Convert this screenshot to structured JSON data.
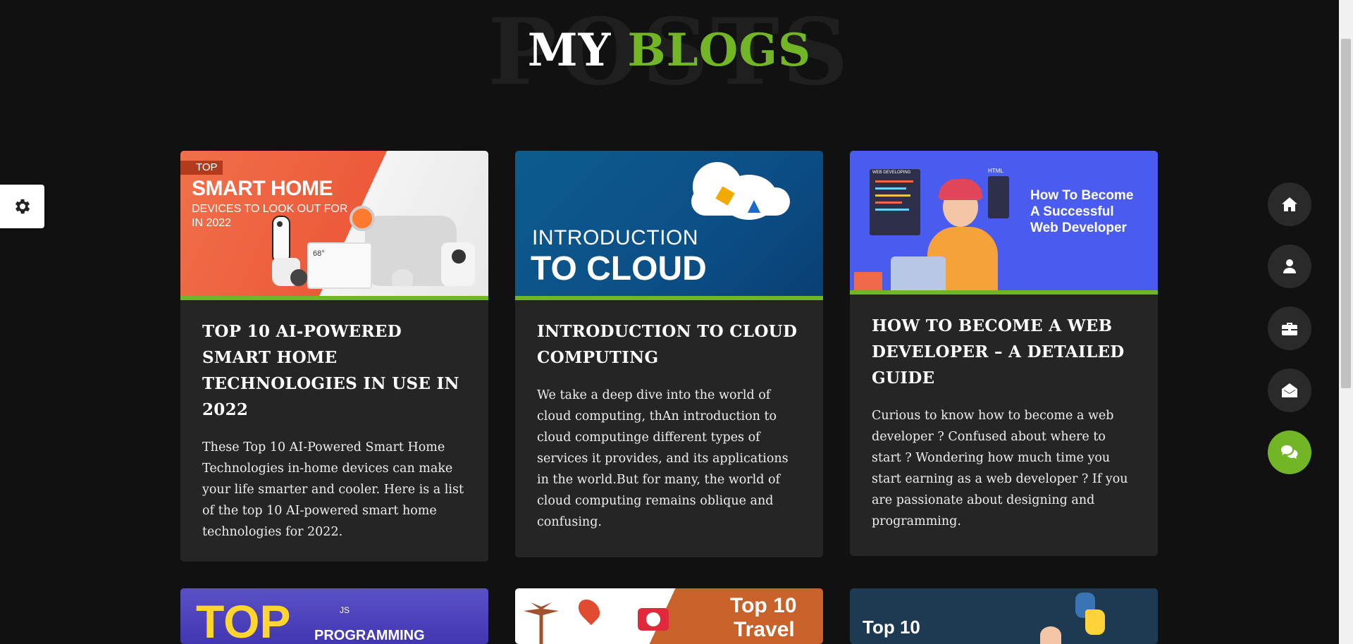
{
  "header": {
    "background_word": "POSTS",
    "title_part1": "MY",
    "title_part2": "BLOGS"
  },
  "colors": {
    "accent": "#72b626",
    "background": "#111111",
    "card": "#252525",
    "nav_button": "#2b2a2a"
  },
  "settings": {
    "icon": "gear-icon"
  },
  "nav": {
    "items": [
      {
        "icon": "home-icon",
        "active": false
      },
      {
        "icon": "user-icon",
        "active": false
      },
      {
        "icon": "briefcase-icon",
        "active": false
      },
      {
        "icon": "envelope-open-icon",
        "active": false
      },
      {
        "icon": "comments-icon",
        "active": true
      }
    ]
  },
  "posts": [
    {
      "title": "Top 10 AI-Powered Smart Home Technologies in Use in 2022",
      "excerpt": "These Top 10 AI-Powered Smart Home Technologies in-home devices can make your life smarter and cooler. Here is a list of the top 10 AI-powered smart home technologies for 2022.",
      "image": {
        "tag": "TOP",
        "headline": "SMART HOME",
        "sub1": "DEVICES TO LOOK OUT FOR",
        "sub2": "IN 2022",
        "thermostat": "68°"
      }
    },
    {
      "title": "Introduction to Cloud Computing",
      "excerpt": "We take a deep dive into the world of cloud computing, thAn introduction to cloud computinge different types of services it provides, and its applications in the world.But for many, the world of cloud computing remains oblique and confusing.",
      "image": {
        "line1": "INTRODUCTION",
        "line2": "TO CLOUD"
      }
    },
    {
      "title": "How to Become a Web Developer – A Detailed Guide",
      "excerpt": "Curious to know how to become a web developer ? Confused about where to start ? Wondering how much time you start earning as a web developer ? If you are passionate about designing and programming.",
      "image": {
        "line1": "How To Become",
        "line2": "A Successful",
        "line3": "Web Developer",
        "small1": "WEB DEVELOPING",
        "small2": "HTML"
      }
    }
  ],
  "next_row": [
    {
      "image": {
        "line1": "TOP",
        "line2": "PROGRAMMING",
        "small": "JS"
      }
    },
    {
      "image": {
        "line1": "Top 10",
        "line2": "Travel"
      }
    },
    {
      "image": {
        "line1": "Top 10"
      }
    }
  ]
}
